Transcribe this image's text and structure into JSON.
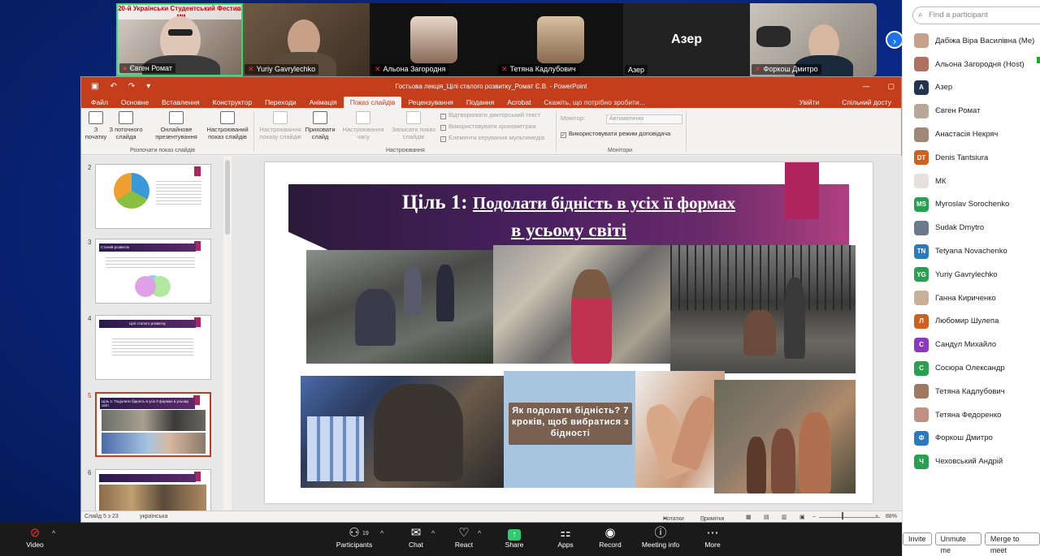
{
  "video_strip": {
    "tiles": [
      {
        "name": "Євген Ромат",
        "banner": "20-й Українськи  Студентський Фестива  ми"
      },
      {
        "name": "Yuriy Gavrylechko"
      },
      {
        "name": "Альона Загородня"
      },
      {
        "name": "Тетяна Кадлубович"
      },
      {
        "name": "Азер",
        "big_text": "Азер"
      },
      {
        "name": "Форкош  Дмитро"
      }
    ],
    "next_arrow": "›"
  },
  "powerpoint": {
    "title": "Гостьова лекція_Цілі сталого розвитку_Ромат Є.В. - PowerPoint",
    "tabs": [
      "Файл",
      "Основне",
      "Вставлення",
      "Конструктор",
      "Переходи",
      "Анімація",
      "Показ слайдів",
      "Рецензування",
      "Подання",
      "Acrobat",
      "Скажіть, що потрібно зробити..."
    ],
    "tabs_right": [
      "Увійти",
      "Спільний досту"
    ],
    "ribbon": {
      "from_start": "З початку",
      "from_current": "З поточного слайда",
      "online": "Онлайнове презентування",
      "custom": "Настроюваний показ слайдів",
      "group1": "Розпочати показ слайдів",
      "setup": "Настроювання показу слайдів",
      "hide": "Приховати слайд",
      "timing": "Настроювання часу",
      "record": "Записати показ слайдів",
      "chk_narration": "Відтворювати дикторський текст",
      "chk_timings": "Використовувати хронометраж",
      "chk_media": "Елементи керування мультимедіа",
      "group2": "Настроювання",
      "monitor_label": "Монітор:",
      "monitor_value": "Автоматично",
      "presenter_view": "Використовувати режим доповідача",
      "group3": "Монітори"
    },
    "thumbnails": [
      {
        "num": "2"
      },
      {
        "num": "3",
        "title": "Сталий розвиток"
      },
      {
        "num": "4",
        "title": "Цілі сталого розвитку"
      },
      {
        "num": "5",
        "title": "Ціль 1: Подолати бідність в усіх її формах в усьому світі"
      },
      {
        "num": "6"
      }
    ],
    "slide": {
      "title_prefix": "Ціль 1:",
      "title_rest": "Подолати бідність в усіх її формах",
      "title_line2": "в усьому світі",
      "box_text": "Як подолати бідність? 7 кроків, щоб вибратися з бідності"
    },
    "status": {
      "slide_of": "Слайд 5 з 23",
      "language": "українська",
      "notes": "Нотатки",
      "comments": "Примітки",
      "zoom": "88%"
    }
  },
  "participants_panel": {
    "search_placeholder": "Find a participant",
    "participants": [
      {
        "name": "Дабіжа Віра Василівна (Me)",
        "initials": "",
        "color": "#c9a08a"
      },
      {
        "name": "Альона Загородня (Host)",
        "initials": "",
        "color": "#b07060"
      },
      {
        "name": "Азер",
        "initials": "A",
        "color": "#24334f"
      },
      {
        "name": "Євген Ромат",
        "initials": "",
        "color": "#b8a898"
      },
      {
        "name": "Анастасія Некряч",
        "initials": "",
        "color": "#a08878"
      },
      {
        "name": "Denis Tantsiura",
        "initials": "DT",
        "color": "#d06020"
      },
      {
        "name": "МК",
        "initials": "",
        "color": "#e8e0da"
      },
      {
        "name": "Myroslav Sorochenko",
        "initials": "MS",
        "color": "#28a050"
      },
      {
        "name": "Sudak Dmytro",
        "initials": "",
        "color": "#6a7a8a"
      },
      {
        "name": "Tetyana Novachenko",
        "initials": "TN",
        "color": "#2a7ac0"
      },
      {
        "name": "Yuriy Gavrylechko",
        "initials": "YG",
        "color": "#28a050"
      },
      {
        "name": "Ганна Кириченко",
        "initials": "",
        "color": "#c8b098"
      },
      {
        "name": "Любомир Шулепа",
        "initials": "Л",
        "color": "#d06020"
      },
      {
        "name": "Сандул Михайло",
        "initials": "С",
        "color": "#8a3ac0"
      },
      {
        "name": "Сосюра Олександр",
        "initials": "С",
        "color": "#28a050"
      },
      {
        "name": "Тетяна Кадлубович",
        "initials": "",
        "color": "#a07860"
      },
      {
        "name": "Тетяна Федоренко",
        "initials": "",
        "color": "#c09080"
      },
      {
        "name": "Форкош  Дмитро",
        "initials": "Ф",
        "color": "#2a7ac0"
      },
      {
        "name": "Чеховський Андрій",
        "initials": "Ч",
        "color": "#28a050"
      }
    ],
    "buttons": {
      "invite": "Invite",
      "unmute": "Unmute me",
      "merge": "Merge to meet"
    }
  },
  "toolbar": {
    "video": "Video",
    "participants": "Participants",
    "participants_count": "19",
    "chat": "Chat",
    "react": "React",
    "share": "Share",
    "apps": "Apps",
    "record": "Record",
    "meeting_info": "Meeting info",
    "more": "More"
  }
}
